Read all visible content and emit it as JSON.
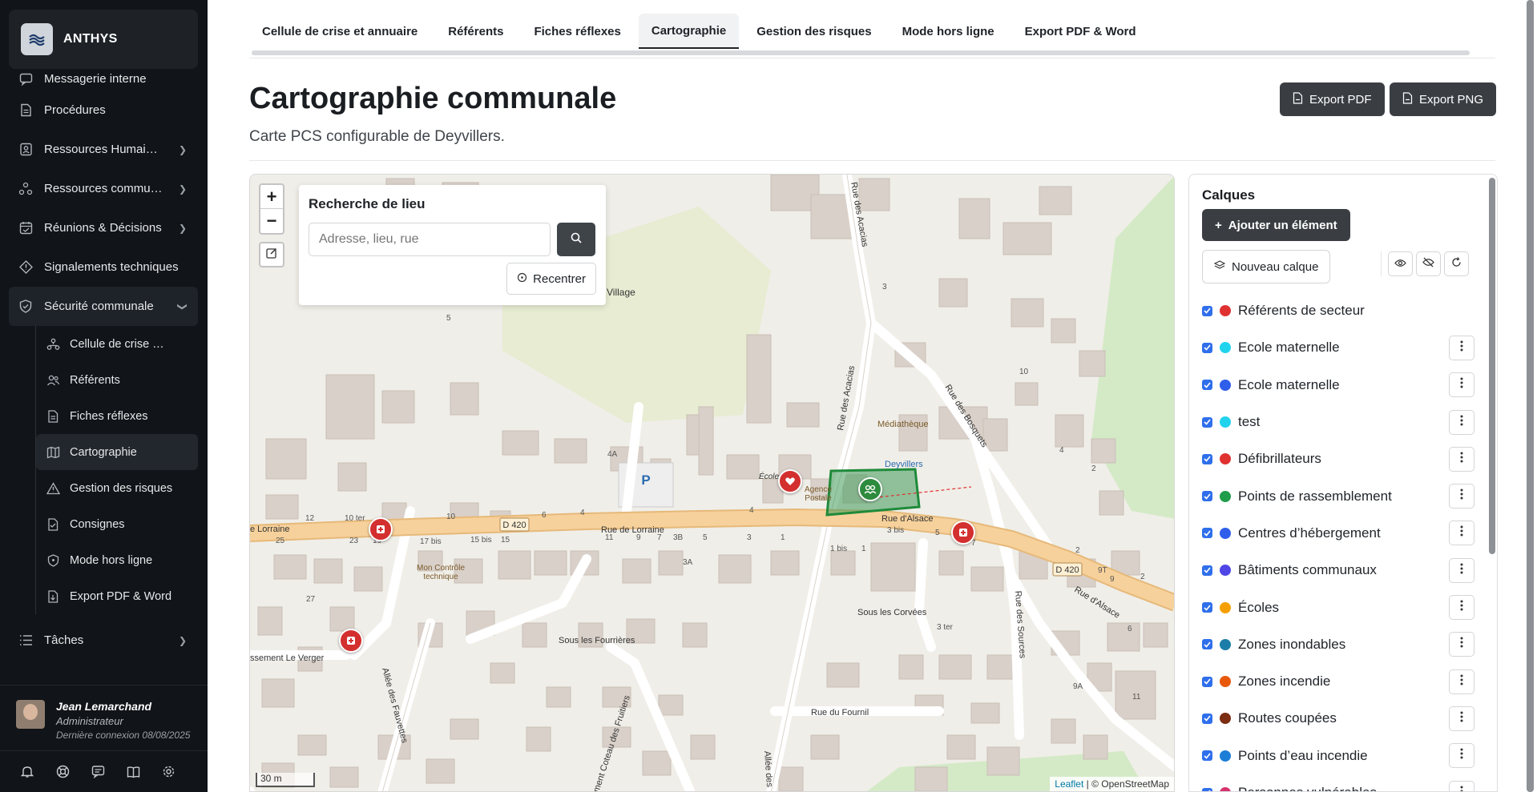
{
  "app": {
    "name": "ANTHYS"
  },
  "sidebar": {
    "items": [
      {
        "label": "Messagerie interne",
        "icon": "message-icon"
      },
      {
        "label": "Procédures",
        "icon": "document-icon"
      },
      {
        "label": "Ressources Humaines",
        "icon": "id-card-icon"
      },
      {
        "label": "Ressources communales",
        "icon": "nodes-icon"
      },
      {
        "label": "Réunions & Décisions",
        "icon": "calendar-icon"
      },
      {
        "label": "Signalements techniques",
        "icon": "warning-diamond-icon"
      },
      {
        "label": "Sécurité communale",
        "icon": "shield-icon"
      }
    ],
    "sub_items": [
      {
        "label": "Cellule de crise et annuaire",
        "icon": "org-icon"
      },
      {
        "label": "Référents",
        "icon": "users-icon"
      },
      {
        "label": "Fiches réflexes",
        "icon": "file-icon"
      },
      {
        "label": "Cartographie",
        "icon": "map-icon"
      },
      {
        "label": "Gestion des risques",
        "icon": "triangle-icon"
      },
      {
        "label": "Consignes",
        "icon": "checklist-icon"
      },
      {
        "label": "Mode hors ligne",
        "icon": "shield-small-icon"
      },
      {
        "label": "Export PDF & Word",
        "icon": "export-icon"
      }
    ],
    "tasks": {
      "label": "Tâches",
      "icon": "list-icon"
    }
  },
  "user": {
    "name": "Jean Lemarchand",
    "role": "Administrateur",
    "last_login": "Dernière connexion 08/08/2025"
  },
  "tabs": [
    "Cellule de crise et annuaire",
    "Référents",
    "Fiches réflexes",
    "Cartographie",
    "Gestion des risques",
    "Mode hors ligne",
    "Export PDF & Word"
  ],
  "page": {
    "title": "Cartographie communale",
    "subtitle": "Carte PCS configurable de Deyvillers.",
    "export_pdf": "Export PDF",
    "export_png": "Export PNG"
  },
  "map": {
    "search_title": "Recherche de lieu",
    "search_placeholder": "Adresse, lieu, rue",
    "recenter": "Recentrer",
    "scale": "30 m",
    "attribution_leaflet": "Leaflet",
    "attribution_osm": " | © OpenStreetMap",
    "labels": {
      "village": "Village",
      "mediatheque": "Médiathèque",
      "deyvillers": "Deyvillers",
      "agence_postale": "Agence\nPostale",
      "ecole": "École",
      "rue_de_lorraine_1": "e Lorraine",
      "rue_de_lorraine_2": "Rue de Lorraine",
      "rue_dalsace_1": "Rue d'Alsace",
      "rue_dalsace_2": "Rue d'Alsace",
      "d420_1": "D 420",
      "d420_2": "D 420",
      "mon_controle": "Mon Contrôle\ntechnique",
      "sous_les_fourrieres": "Sous les Fourrières",
      "sous_les_corvees": "Sous les Corvées",
      "rue_du_fournil": "Rue du Fournil",
      "rue_des_acacias": "Rue des Acacias",
      "rue_des_bosquets": "Rue des Bosquets",
      "rue_des_sources": "Rue des Sources",
      "allee_des_fauvettes": "Allée des Fauvettes",
      "coteau_des_fruitiers": "ment Coteau des Fruitiers",
      "le_verger": "ssement Le Verger",
      "allee_des": "Allée des"
    }
  },
  "layers": {
    "title": "Calques",
    "add_button": "Ajouter un élément",
    "new_layer": "Nouveau calque",
    "items": [
      {
        "name": "Référents de secteur",
        "color": "#e03131"
      },
      {
        "name": "Ecole maternelle",
        "color": "#22d3ee"
      },
      {
        "name": "Ecole maternelle",
        "color": "#2f5eea"
      },
      {
        "name": "test",
        "color": "#22d3ee"
      },
      {
        "name": "Défibrillateurs",
        "color": "#e03131"
      },
      {
        "name": "Points de rassemblement",
        "color": "#1f9d4a"
      },
      {
        "name": "Centres d’hébergement",
        "color": "#2f5eea"
      },
      {
        "name": "Bâtiments communaux",
        "color": "#4f46e5"
      },
      {
        "name": "Écoles",
        "color": "#f59f00"
      },
      {
        "name": "Zones inondables",
        "color": "#1c7ea8"
      },
      {
        "name": "Zones incendie",
        "color": "#e8590c"
      },
      {
        "name": "Routes coupées",
        "color": "#7c2d12"
      },
      {
        "name": "Points d’eau incendie",
        "color": "#1c7ed6"
      },
      {
        "name": "Personnes vulnérables",
        "color": "#d6336c"
      }
    ]
  }
}
